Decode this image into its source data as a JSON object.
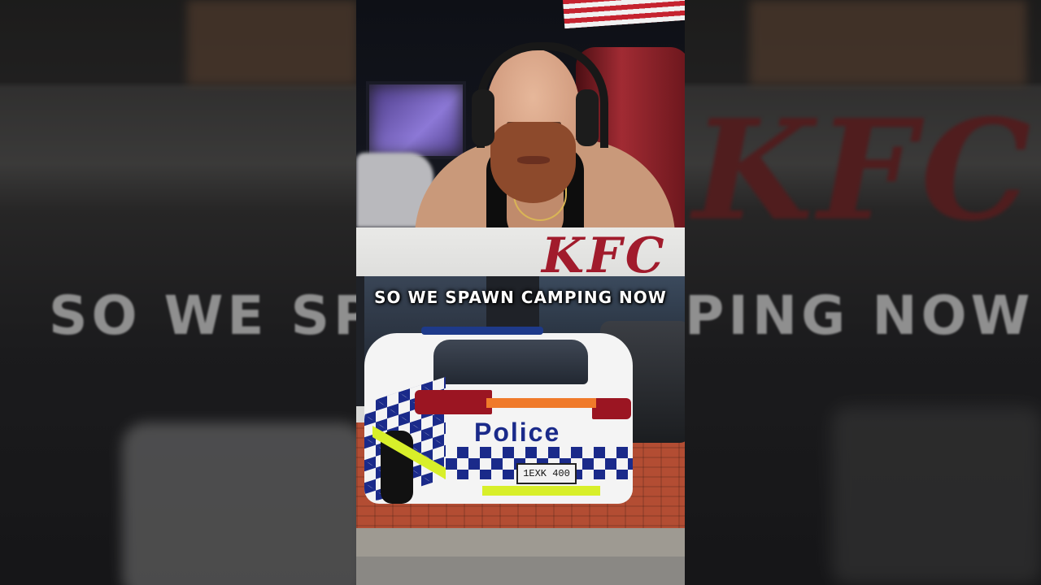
{
  "caption": {
    "text": "SO WE SPAWN CAMPING NOW"
  },
  "background": {
    "blurred_caption_left": "SO WE SP",
    "blurred_caption_right": "PING NOW",
    "blurred_logo": "KFC"
  },
  "scene": {
    "store_sign": "KFC",
    "vehicle_livery_text": "Police",
    "license_plate": "1EXK 400"
  },
  "colors": {
    "caption_text": "#ffffff",
    "kfc_red": "#a11b2c",
    "police_blue": "#1a2a8a",
    "hi_vis_yellow": "#d8ef2a",
    "stripe_orange": "#f07a2a"
  }
}
